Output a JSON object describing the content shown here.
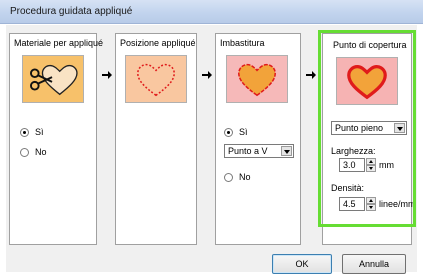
{
  "window": {
    "title": "Procedura guidata appliqué"
  },
  "panels": {
    "material": {
      "title": "Materiale per appliqué",
      "radio_yes": "Sì",
      "radio_no": "No",
      "selected": "yes",
      "image_bg": "#f7c16a"
    },
    "position": {
      "title": "Posizione appliqué",
      "image_bg": "#f9c7a0"
    },
    "basting": {
      "title": "Imbastitura",
      "radio_yes": "Sì",
      "radio_no": "No",
      "selected": "yes",
      "stitch_select": "Punto a V",
      "image_bg": "#f6b9b9"
    },
    "covering": {
      "title": "Punto di copertura",
      "stitch_select": "Punto pieno",
      "width_label": "Larghezza:",
      "width_value": "3.0",
      "width_unit": "mm",
      "density_label": "Densità:",
      "density_value": "4.5",
      "density_unit": "linee/mm",
      "image_bg": "#f6b3b3"
    }
  },
  "buttons": {
    "ok": "OK",
    "cancel": "Annulla"
  },
  "colors": {
    "highlight": "#66dd33",
    "heart_red": "#e01b1b",
    "heart_orange": "#f2a33a"
  }
}
